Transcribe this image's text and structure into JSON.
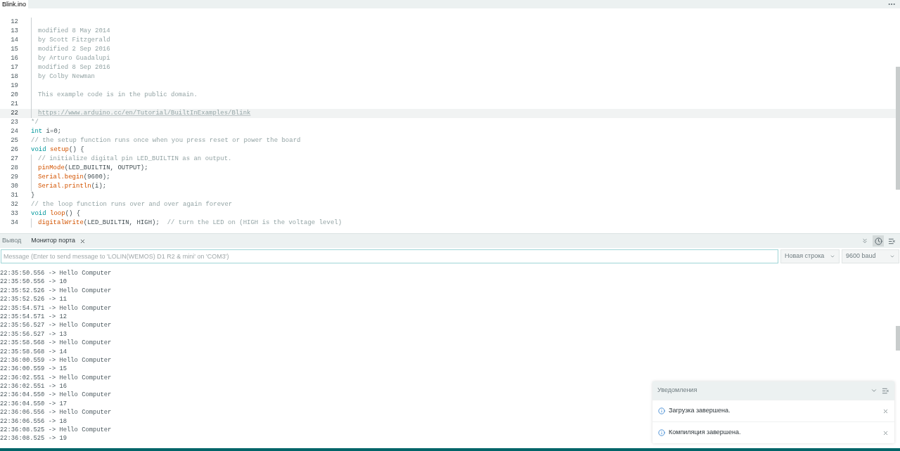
{
  "editor": {
    "tabs": [
      {
        "label": "Blink.ino",
        "selected": true
      }
    ],
    "lines": [
      {
        "number": "12",
        "current": false,
        "indented": true
      },
      {
        "number": "13",
        "current": false,
        "indented": true,
        "segments": [
          {
            "kind": "comment",
            "text": "modified 8 May 2014"
          }
        ]
      },
      {
        "number": "14",
        "current": false,
        "indented": true,
        "segments": [
          {
            "kind": "comment",
            "text": "by Scott Fitzgerald"
          }
        ]
      },
      {
        "number": "15",
        "current": false,
        "indented": true,
        "segments": [
          {
            "kind": "comment",
            "text": "modified 2 Sep 2016"
          }
        ]
      },
      {
        "number": "16",
        "current": false,
        "indented": true,
        "segments": [
          {
            "kind": "comment",
            "text": "by Arturo Guadalupi"
          }
        ]
      },
      {
        "number": "17",
        "current": false,
        "indented": true,
        "segments": [
          {
            "kind": "comment",
            "text": "modified 8 Sep 2016"
          }
        ]
      },
      {
        "number": "18",
        "current": false,
        "indented": true,
        "segments": [
          {
            "kind": "comment",
            "text": "by Colby Newman"
          }
        ]
      },
      {
        "number": "19",
        "current": false,
        "indented": true
      },
      {
        "number": "20",
        "current": false,
        "indented": true,
        "segments": [
          {
            "kind": "comment",
            "text": "This example code is in the public domain."
          }
        ]
      },
      {
        "number": "21",
        "current": false,
        "indented": true
      },
      {
        "number": "22",
        "current": true,
        "indented": true,
        "segments": [
          {
            "kind": "link",
            "text": "https://www.arduino.cc/en/Tutorial/BuiltInExamples/Blink"
          }
        ]
      },
      {
        "number": "23",
        "current": false,
        "indented": false,
        "segments": [
          {
            "kind": "comment",
            "text": "*/"
          }
        ]
      },
      {
        "number": "24",
        "current": false,
        "indented": false,
        "segments": [
          {
            "kind": "keyword",
            "text": "int"
          },
          {
            "kind": "plain",
            "text": " i=0;"
          }
        ]
      },
      {
        "number": "25",
        "current": false,
        "indented": false,
        "segments": [
          {
            "kind": "comment",
            "text": "// the setup function runs once when you press reset or power the board"
          }
        ]
      },
      {
        "number": "26",
        "current": false,
        "indented": false,
        "segments": [
          {
            "kind": "keyword",
            "text": "void"
          },
          {
            "kind": "function",
            "text": " setup"
          },
          {
            "kind": "plain",
            "text": "() {"
          }
        ]
      },
      {
        "number": "27",
        "current": false,
        "indented": true,
        "segments": [
          {
            "kind": "comment",
            "text": "// initialize digital pin LED_BUILTIN as an output."
          }
        ]
      },
      {
        "number": "28",
        "current": false,
        "indented": true,
        "segments": [
          {
            "kind": "function",
            "text": "pinMode"
          },
          {
            "kind": "plain",
            "text": "(LED_BUILTIN, OUTPUT);"
          }
        ]
      },
      {
        "number": "29",
        "current": false,
        "indented": true,
        "segments": [
          {
            "kind": "function",
            "text": "Serial.begin"
          },
          {
            "kind": "plain",
            "text": "(9600);"
          }
        ]
      },
      {
        "number": "30",
        "current": false,
        "indented": true,
        "segments": [
          {
            "kind": "function",
            "text": "Serial.println"
          },
          {
            "kind": "plain",
            "text": "(i);"
          }
        ]
      },
      {
        "number": "31",
        "current": false,
        "indented": false,
        "segments": [
          {
            "kind": "plain",
            "text": "}"
          }
        ]
      },
      {
        "number": "32",
        "current": false,
        "indented": false,
        "segments": [
          {
            "kind": "comment",
            "text": "// the loop function runs over and over again forever"
          }
        ]
      },
      {
        "number": "33",
        "current": false,
        "indented": false,
        "segments": [
          {
            "kind": "keyword",
            "text": "void"
          },
          {
            "kind": "function",
            "text": " loop"
          },
          {
            "kind": "plain",
            "text": "() {"
          }
        ]
      },
      {
        "number": "34",
        "current": false,
        "indented": true,
        "segments": [
          {
            "kind": "function",
            "text": "digitalWrite"
          },
          {
            "kind": "plain",
            "text": "(LED_BUILTIN, HIGH);  "
          },
          {
            "kind": "comment",
            "text": "// turn the LED on (HIGH is the voltage level)"
          }
        ]
      }
    ]
  },
  "panel": {
    "tabs": [
      {
        "label": "Вывод",
        "selected": false,
        "closable": false
      },
      {
        "label": "Монитор порта",
        "selected": true,
        "closable": true
      }
    ],
    "timestamp_toggle": {
      "on": true
    },
    "message_field": {
      "placeholder": "Message (Enter to send message to 'LOLIN(WEMOS) D1 R2 & mini' on 'COM3')"
    },
    "line_ending": "Новая строка",
    "baud_rate": "9600 baud",
    "output": [
      "22:35:50.556 -> Hello Computer",
      "22:35:50.556 -> 10",
      "22:35:52.526 -> Hello Computer",
      "22:35:52.526 -> 11",
      "22:35:54.571 -> Hello Computer",
      "22:35:54.571 -> 12",
      "22:35:56.527 -> Hello Computer",
      "22:35:56.527 -> 13",
      "22:35:58.568 -> Hello Computer",
      "22:35:58.568 -> 14",
      "22:36:00.559 -> Hello Computer",
      "22:36:00.559 -> 15",
      "22:36:02.551 -> Hello Computer",
      "22:36:02.551 -> 16",
      "22:36:04.550 -> Hello Computer",
      "22:36:04.550 -> 17",
      "22:36:06.556 -> Hello Computer",
      "22:36:06.556 -> 18",
      "22:36:08.525 -> Hello Computer",
      "22:36:08.525 -> 19"
    ]
  },
  "notifications": {
    "title": "Уведомления",
    "items": [
      {
        "text": "Загрузка завершена."
      },
      {
        "text": "Компиляция завершена."
      }
    ]
  }
}
